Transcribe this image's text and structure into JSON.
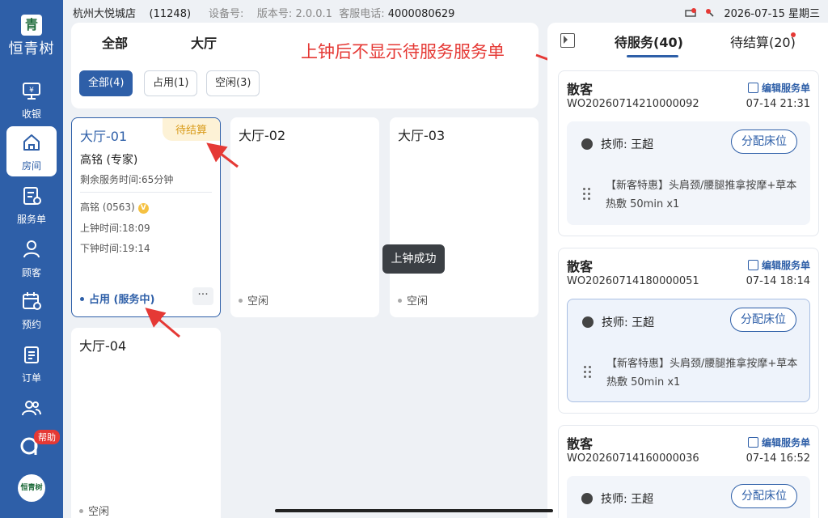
{
  "status_bar": {
    "store": "杭州大悦城店",
    "store_code": "(11248)",
    "device_label": "设备号:",
    "version_label": "版本号:",
    "version": "2.0.0.1",
    "hotline_label": "客服电话:",
    "hotline": "4000080629",
    "datetime": "2026-07-15 星期三"
  },
  "sidebar": {
    "brand": "恒青树",
    "items": [
      {
        "label": "收银",
        "icon": "cashier-icon"
      },
      {
        "label": "房间",
        "icon": "home-icon"
      },
      {
        "label": "服务单",
        "icon": "service-order-icon"
      },
      {
        "label": "顾客",
        "icon": "customer-icon"
      },
      {
        "label": "预约",
        "icon": "calendar-icon"
      },
      {
        "label": "订单",
        "icon": "order-icon"
      }
    ],
    "help_badge": "帮助"
  },
  "filter": {
    "tabs": [
      "全部",
      "大厅"
    ],
    "chips": [
      "全部(4)",
      "占用(1)",
      "空闲(3)"
    ]
  },
  "annotation": "上钟后不显示待服务服务单",
  "rooms": [
    {
      "name": "大厅-01",
      "badge": "待结算",
      "tech": "高铭 (专家)",
      "remaining": "剩余服务时间:65分钟",
      "customer": "高铭 (0563)",
      "vip": "V",
      "start": "上钟时间:18:09",
      "end": "下钟时间:19:14",
      "status": "占用 (服务中)",
      "more": "···"
    },
    {
      "name": "大厅-02",
      "status": "空闲"
    },
    {
      "name": "大厅-03",
      "status": "空闲"
    },
    {
      "name": "大厅-04",
      "status": "空闲"
    }
  ],
  "toast": "上钟成功",
  "right_panel": {
    "tabs": [
      "待服务(40)",
      "待结算(20)"
    ],
    "orders": [
      {
        "customer": "散客",
        "edit": "编辑服务单",
        "no": "WO20260714210000092",
        "time": "07-14 21:31",
        "tech": "技师: 王超",
        "assign": "分配床位",
        "service": "【新客特惠】头肩颈/腰腿推拿按摩+草本热敷 50min x1"
      },
      {
        "customer": "散客",
        "edit": "编辑服务单",
        "no": "WO20260714180000051",
        "time": "07-14 18:14",
        "tech": "技师: 王超",
        "assign": "分配床位",
        "service": "【新客特惠】头肩颈/腰腿推拿按摩+草本热敷 50min x1"
      },
      {
        "customer": "散客",
        "edit": "编辑服务单",
        "no": "WO20260714160000036",
        "time": "07-14 16:52",
        "tech": "技师: 王超",
        "assign": "分配床位"
      }
    ]
  },
  "colors": {
    "primary": "#2e5fa8",
    "annotation": "#e53935",
    "pending": "#d89a18"
  }
}
